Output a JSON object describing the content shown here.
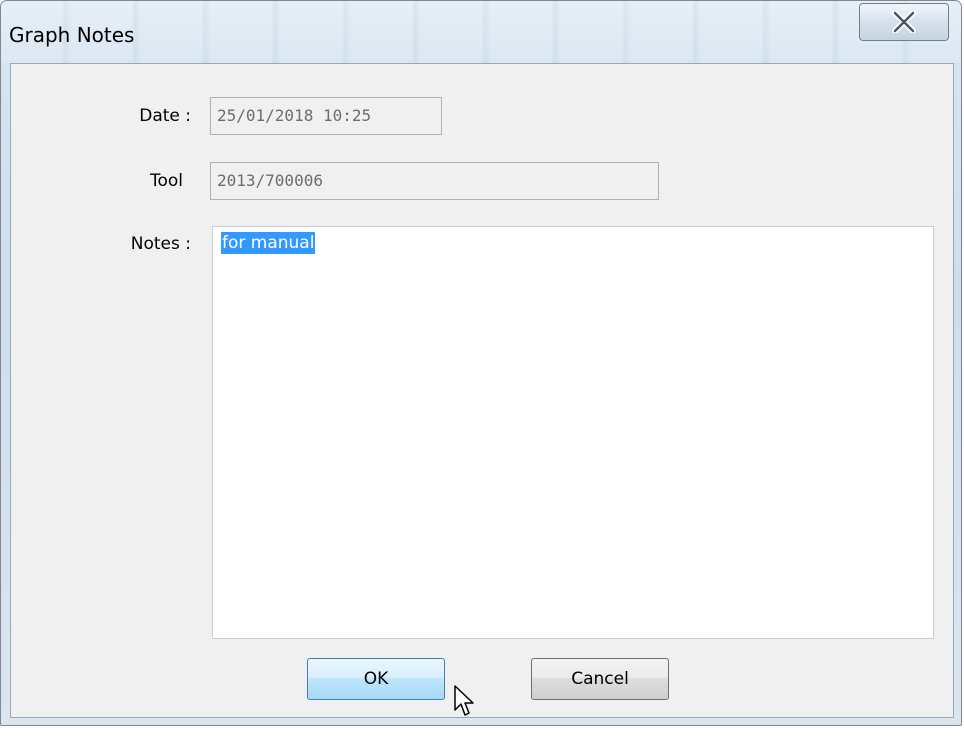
{
  "window": {
    "title": "Graph Notes"
  },
  "form": {
    "date_label": "Date :",
    "date_value": "25/01/2018 10:25",
    "tool_label": "Tool",
    "tool_value": "2013/700006",
    "notes_label": "Notes :",
    "notes_value": "for manual"
  },
  "buttons": {
    "ok_label": "OK",
    "cancel_label": "Cancel"
  },
  "icons": {
    "close": "close-icon",
    "cursor": "mouse-pointer-icon"
  },
  "colors": {
    "selection": "#3399ff",
    "default_button_border": "#3c7fb1"
  }
}
